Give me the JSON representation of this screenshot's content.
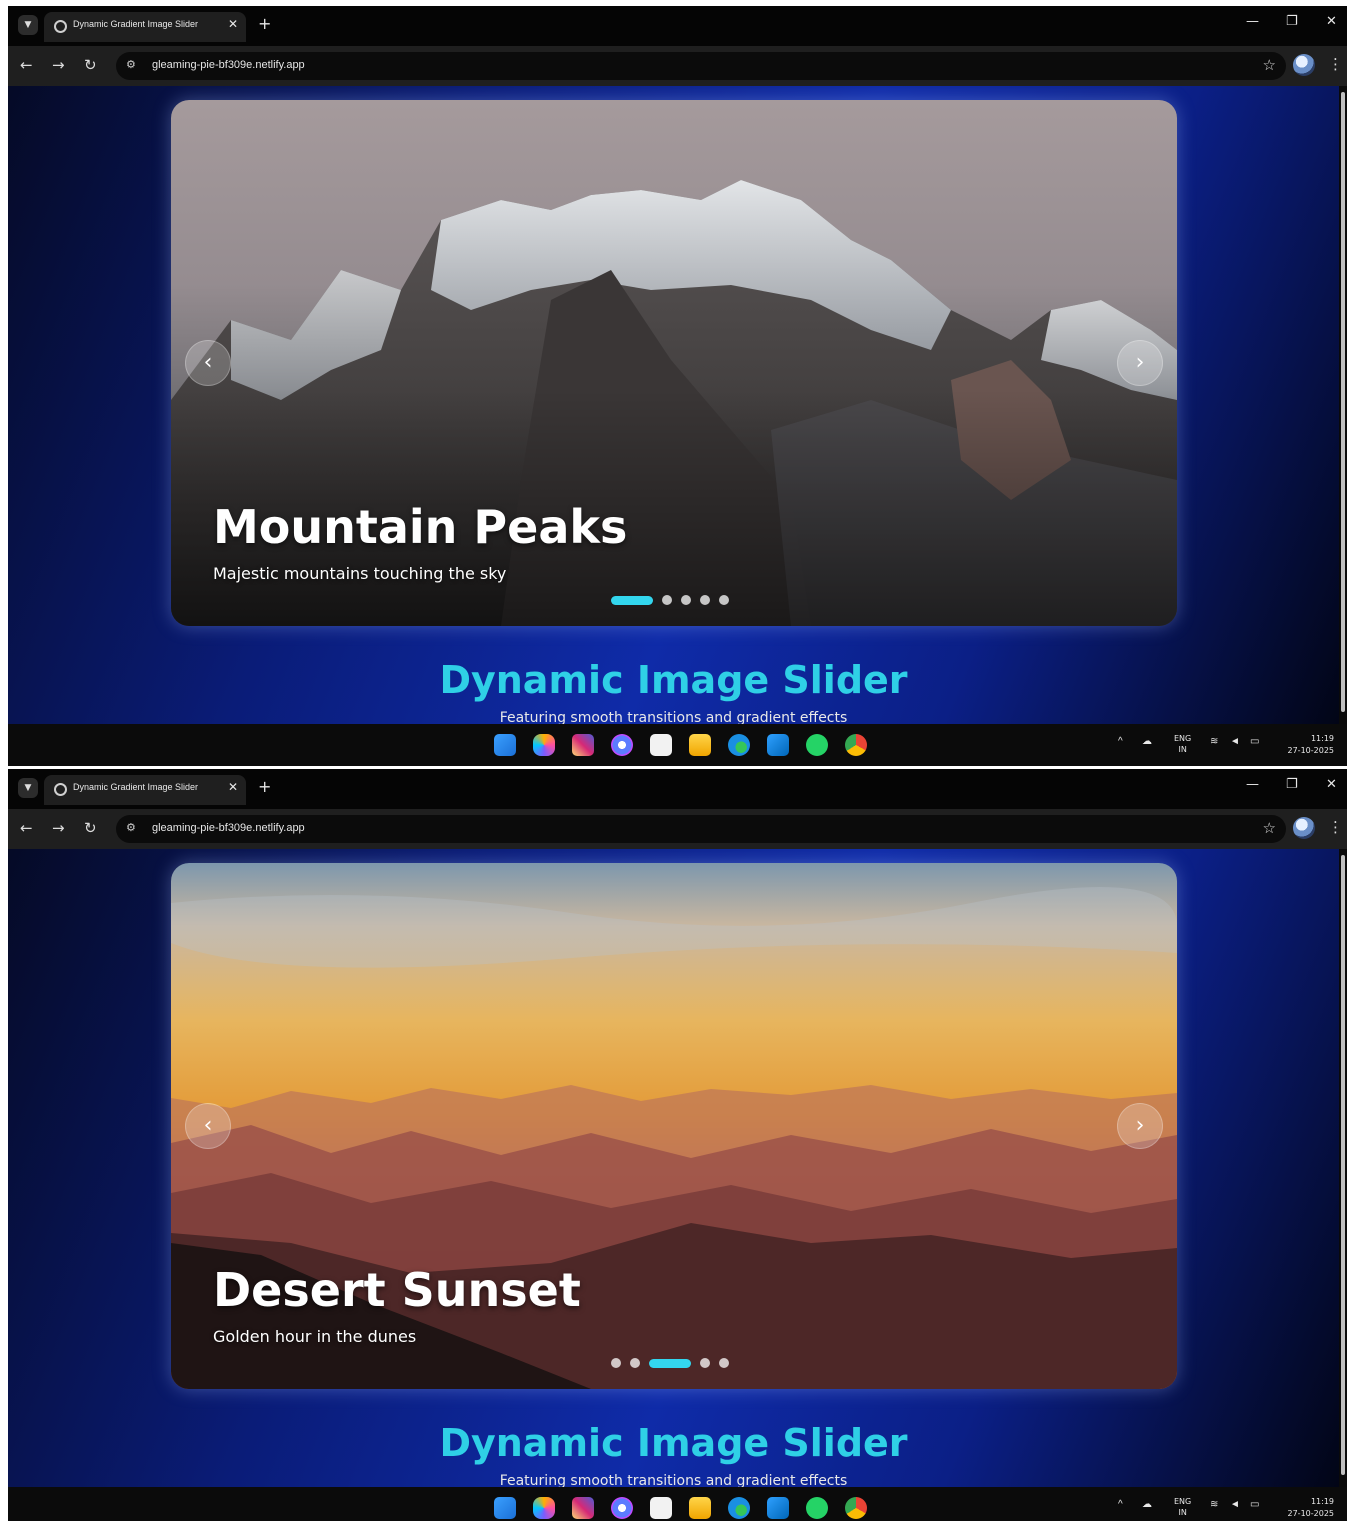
{
  "screens": [
    {
      "tab_title": "Dynamic Gradient Image Slider",
      "url": "gleaming-pie-bf309e.netlify.app",
      "slide_title": "Mountain Peaks",
      "slide_subtitle": "Majestic mountains touching the sky",
      "active_dot_index": 0,
      "dot_count": 5,
      "page_title": "Dynamic Image Slider",
      "page_subtitle": "Featuring smooth transitions and gradient effects",
      "tray_lang": "ENG",
      "tray_region": "IN",
      "clock_time": "11:19",
      "clock_date": "27-10-2025"
    },
    {
      "tab_title": "Dynamic Gradient Image Slider",
      "url": "gleaming-pie-bf309e.netlify.app",
      "slide_title": "Desert Sunset",
      "slide_subtitle": "Golden hour in the dunes",
      "active_dot_index": 2,
      "dot_count": 5,
      "page_title": "Dynamic Image Slider",
      "page_subtitle": "Featuring smooth transitions and gradient effects",
      "tray_lang": "ENG",
      "tray_region": "IN",
      "clock_time": "11:19",
      "clock_date": "27-10-2025"
    }
  ],
  "icons": {
    "tab_menu": "chevron-down-icon",
    "tab_close": "close-icon",
    "new_tab": "plus-icon",
    "back": "arrow-left-icon",
    "forward": "arrow-right-icon",
    "reload": "reload-icon",
    "site_info": "tune-icon",
    "bookmark": "star-icon",
    "menu": "kebab-icon",
    "prev_slide": "chevron-left-icon",
    "next_slide": "chevron-right-icon"
  },
  "colors": {
    "accent": "#2fd0e6",
    "active_dot": "#33d6ee",
    "browser_bg": "#1f1f1f"
  }
}
